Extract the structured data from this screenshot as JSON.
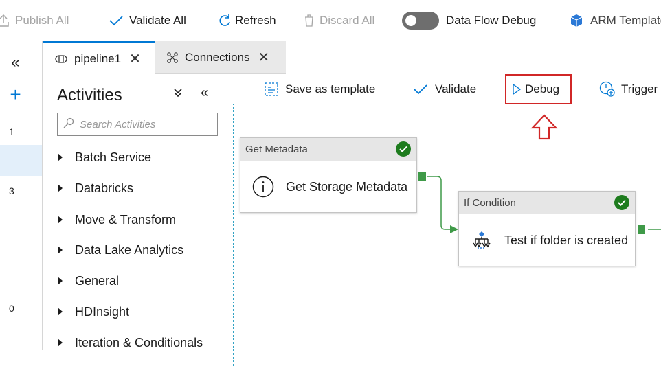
{
  "toolbar": {
    "publish_all": "Publish All",
    "validate_all": "Validate All",
    "refresh": "Refresh",
    "discard_all": "Discard All",
    "data_flow_debug": "Data Flow Debug",
    "arm_template": "ARM Template"
  },
  "rail": {
    "collapse_glyph": "«",
    "add_glyph": "+",
    "counts": [
      "1",
      "3",
      "0"
    ]
  },
  "tabs": [
    {
      "label": "pipeline1",
      "icon": "pipeline-icon",
      "active": true
    },
    {
      "label": "Connections",
      "icon": "connections-icon",
      "active": false
    }
  ],
  "activities": {
    "title": "Activities",
    "search_placeholder": "Search Activities",
    "categories": [
      "Batch Service",
      "Databricks",
      "Move & Transform",
      "Data Lake Analytics",
      "General",
      "HDInsight",
      "Iteration & Conditionals"
    ]
  },
  "canvas_toolbar": {
    "save_as_template": "Save as template",
    "validate": "Validate",
    "debug": "Debug",
    "trigger": "Trigger"
  },
  "nodes": [
    {
      "type": "Get Metadata",
      "name": "Get Storage Metadata",
      "status": "succeeded"
    },
    {
      "type": "If Condition",
      "name": "Test if folder is created",
      "status": "succeeded"
    }
  ],
  "colors": {
    "accent": "#0078d4",
    "highlight_red": "#d12727",
    "success_green": "#1e7c1e",
    "connector_green": "#3f9a48"
  }
}
